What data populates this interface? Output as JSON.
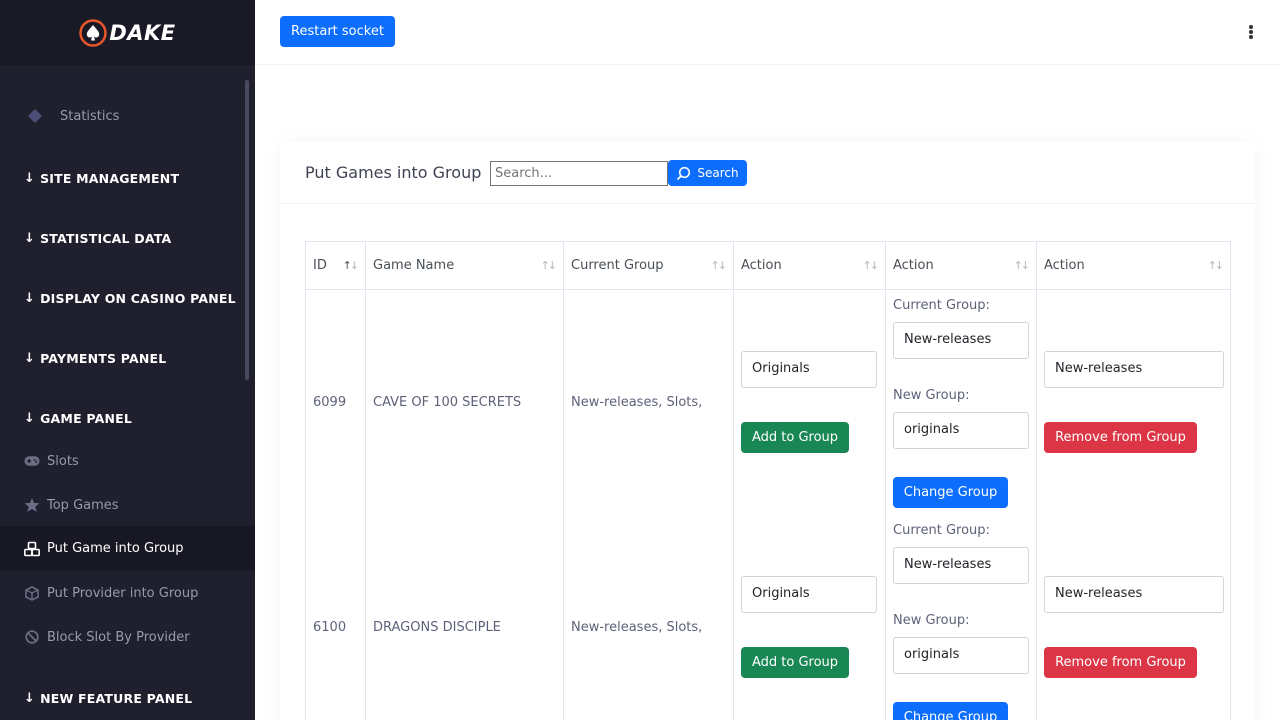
{
  "brand": {
    "name": "DAKE",
    "accent": "#e8562a"
  },
  "header": {
    "restart_label": "Restart socket",
    "menu_icon": "kebab-icon"
  },
  "sidebar": {
    "statistics": "Statistics",
    "sections": [
      "SITE MANAGEMENT",
      "STATISTICAL DATA",
      "DISPLAY ON CASINO PANEL",
      "PAYMENTS PANEL",
      "GAME PANEL",
      "NEW FEATURE PANEL"
    ],
    "game_items": [
      {
        "label": "Slots",
        "icon": "gamepad-icon"
      },
      {
        "label": "Top Games",
        "icon": "star-icon"
      },
      {
        "label": "Put Game into Group",
        "icon": "cubes-icon",
        "active": true
      },
      {
        "label": "Put Provider into Group",
        "icon": "box-icon"
      },
      {
        "label": "Block Slot By Provider",
        "icon": "ban-icon"
      }
    ]
  },
  "card": {
    "title": "Put Games into Group",
    "search_placeholder": "Search...",
    "search_label": "Search"
  },
  "table": {
    "headers": [
      "ID",
      "Game Name",
      "Current Group",
      "Action",
      "Action",
      "Action"
    ],
    "labels": {
      "current_group": "Current Group:",
      "new_group": "New Group:"
    },
    "buttons": {
      "add": "Add to Group",
      "change": "Change Group",
      "remove": "Remove from Group"
    },
    "rows": [
      {
        "id": "6099",
        "name": "CAVE OF 100 SECRETS",
        "current_group": "New-releases, Slots,",
        "add_select": "Originals",
        "current_select": "New-releases",
        "new_select": "originals",
        "remove_select": "New-releases"
      },
      {
        "id": "6100",
        "name": "DRAGONS DISCIPLE",
        "current_group": "New-releases, Slots,",
        "add_select": "Originals",
        "current_select": "New-releases",
        "new_select": "originals",
        "remove_select": "New-releases"
      }
    ]
  },
  "colors": {
    "sidebar_bg": "#1f1f2d",
    "primary": "#0d6efd",
    "success": "#198754",
    "danger": "#dc3545"
  }
}
